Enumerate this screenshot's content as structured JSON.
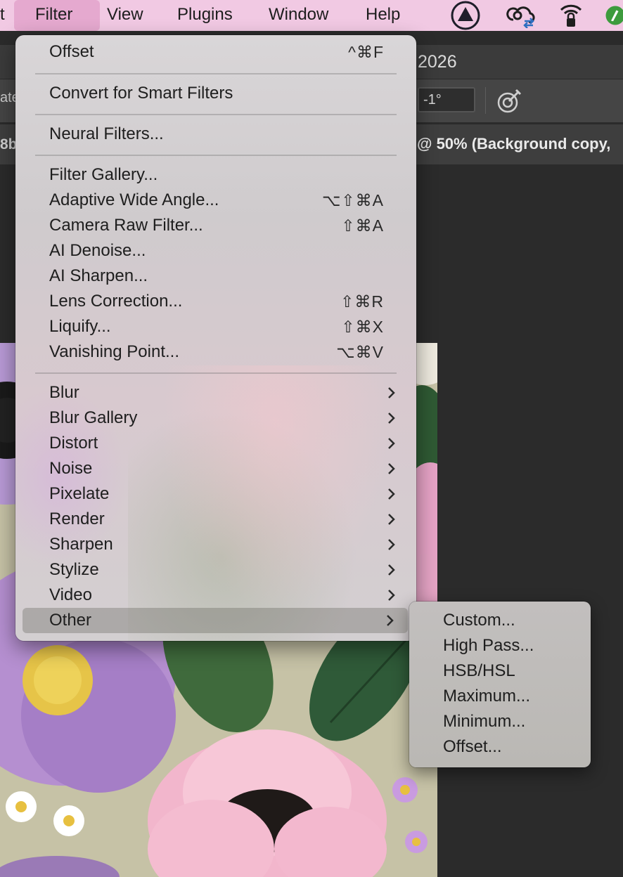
{
  "menubar": {
    "items": [
      {
        "label": "t"
      },
      {
        "label": "Filter"
      },
      {
        "label": "View"
      },
      {
        "label": "Plugins"
      },
      {
        "label": "Window"
      },
      {
        "label": "Help"
      }
    ],
    "icons": [
      "triangle-circle-icon",
      "creative-cloud-sync-icon",
      "wifi-lock-icon",
      "app-icon"
    ]
  },
  "document": {
    "title_fragment": "2026",
    "tab_fragment": "@ 50% (Background copy,",
    "left_fragment_1": "ate",
    "left_fragment_2": "8b",
    "angle_value": "-1°"
  },
  "filter_menu": {
    "items": [
      {
        "label": "Offset",
        "shortcut": "^⌘F"
      },
      {
        "label": "Convert for Smart Filters",
        "shortcut": ""
      },
      {
        "label": "Neural Filters...",
        "shortcut": ""
      },
      {
        "label": "Filter Gallery...",
        "shortcut": ""
      },
      {
        "label": "Adaptive Wide Angle...",
        "shortcut": "⌥⇧⌘A"
      },
      {
        "label": "Camera Raw Filter...",
        "shortcut": "⇧⌘A"
      },
      {
        "label": "AI Denoise...",
        "shortcut": ""
      },
      {
        "label": "AI Sharpen...",
        "shortcut": ""
      },
      {
        "label": "Lens Correction...",
        "shortcut": "⇧⌘R"
      },
      {
        "label": "Liquify...",
        "shortcut": "⇧⌘X"
      },
      {
        "label": "Vanishing Point...",
        "shortcut": "⌥⌘V"
      },
      {
        "label": "Blur",
        "shortcut": ""
      },
      {
        "label": "Blur Gallery",
        "shortcut": ""
      },
      {
        "label": "Distort",
        "shortcut": ""
      },
      {
        "label": "Noise",
        "shortcut": ""
      },
      {
        "label": "Pixelate",
        "shortcut": ""
      },
      {
        "label": "Render",
        "shortcut": ""
      },
      {
        "label": "Sharpen",
        "shortcut": ""
      },
      {
        "label": "Stylize",
        "shortcut": ""
      },
      {
        "label": "Video",
        "shortcut": ""
      },
      {
        "label": "Other",
        "shortcut": ""
      }
    ]
  },
  "other_submenu": {
    "items": [
      {
        "label": "Custom..."
      },
      {
        "label": "High Pass..."
      },
      {
        "label": "HSB/HSL"
      },
      {
        "label": "Maximum..."
      },
      {
        "label": "Minimum..."
      },
      {
        "label": "Offset..."
      }
    ]
  },
  "colors": {
    "menubar_bg": "#f1c9e3",
    "menubar_active": "#e5a9cf",
    "app_bg": "#2b2b2b"
  }
}
